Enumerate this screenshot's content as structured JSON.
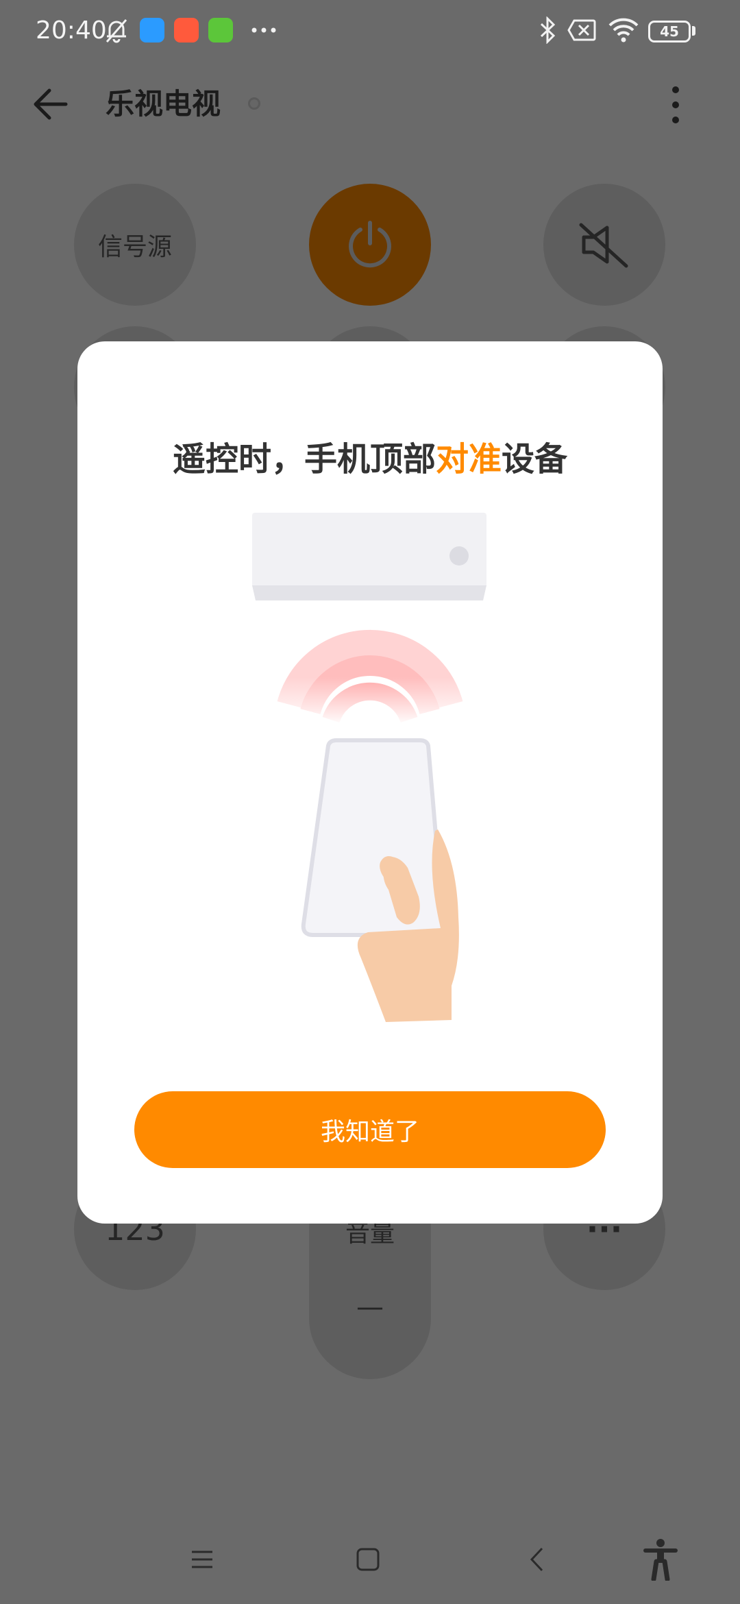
{
  "status_bar": {
    "time": "20:40",
    "battery_level": "45",
    "icons": [
      "mute-bell-icon",
      "app-badge-blue",
      "app-badge-red",
      "app-badge-green",
      "more-dots-icon",
      "bluetooth-icon",
      "sim-off-icon",
      "wifi-icon",
      "battery-icon"
    ]
  },
  "header": {
    "title": "乐视电视",
    "back_icon": "arrow-left-icon",
    "menu_icon": "more-vert-icon"
  },
  "remote": {
    "source_label": "信号源",
    "power_icon": "power-icon",
    "mute_icon": "speaker-mute-icon",
    "numpad_label": "123",
    "volume_label": "音量",
    "volume_minus": "—",
    "more_label": "···",
    "power_color": "#6b3a00"
  },
  "dialog": {
    "title_part1": "遥控时，手机顶部",
    "title_highlight": "对准",
    "title_part2": "设备",
    "highlight_color": "#ff8a00",
    "illustration": "phone-pointing-at-ac-illustration",
    "confirm_label": "我知道了",
    "button_color": "#ff8a00"
  },
  "nav_bar": {
    "items": [
      "menu-icon",
      "home-square-icon",
      "back-chevron-icon",
      "accessibility-icon"
    ]
  }
}
